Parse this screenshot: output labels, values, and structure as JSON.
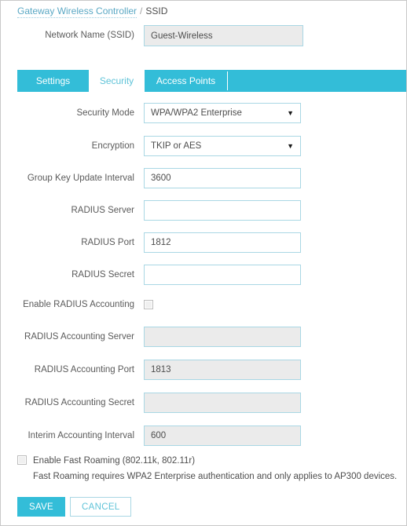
{
  "breadcrumb": {
    "link": "Gateway Wireless Controller",
    "separator": "/",
    "current": "SSID"
  },
  "network_name": {
    "label": "Network Name (SSID)",
    "value": "Guest-Wireless",
    "disabled": true
  },
  "tabs": [
    {
      "label": "Settings",
      "active": false
    },
    {
      "label": "Security",
      "active": true
    },
    {
      "label": "Access Points",
      "active": false
    }
  ],
  "form": {
    "fields": [
      {
        "name": "security-mode",
        "label": "Security Mode",
        "type": "select",
        "value": "WPA/WPA2 Enterprise",
        "arrow": "▼",
        "disabled": false
      },
      {
        "name": "encryption",
        "label": "Encryption",
        "type": "select",
        "value": "TKIP or AES",
        "arrow": "▼",
        "disabled": false
      },
      {
        "name": "group-key-update-interval",
        "label": "Group Key Update Interval",
        "type": "text",
        "value": "3600",
        "disabled": false
      },
      {
        "name": "radius-server",
        "label": "RADIUS Server",
        "type": "text",
        "value": "",
        "disabled": false
      },
      {
        "name": "radius-port",
        "label": "RADIUS Port",
        "type": "text",
        "value": "1812",
        "disabled": false
      },
      {
        "name": "radius-secret",
        "label": "RADIUS Secret",
        "type": "text",
        "value": "",
        "disabled": false
      }
    ],
    "enable_radius_accounting": {
      "label": "Enable RADIUS Accounting",
      "checked": false
    },
    "accounting_fields": [
      {
        "name": "radius-accounting-server",
        "label": "RADIUS Accounting Server",
        "type": "text",
        "value": "",
        "disabled": true
      },
      {
        "name": "radius-accounting-port",
        "label": "RADIUS Accounting Port",
        "type": "text",
        "value": "1813",
        "disabled": true
      },
      {
        "name": "radius-accounting-secret",
        "label": "RADIUS Accounting Secret",
        "type": "text",
        "value": "",
        "disabled": true
      },
      {
        "name": "interim-accounting-interval",
        "label": "Interim Accounting Interval",
        "type": "text",
        "value": "600",
        "disabled": true
      }
    ],
    "fast_roaming": {
      "label": "Enable Fast Roaming (802.11k, 802.11r)",
      "checked": false,
      "help": "Fast Roaming requires WPA2 Enterprise authentication and only applies to AP300 devices."
    }
  },
  "actions": {
    "save": "SAVE",
    "cancel": "CANCEL"
  },
  "colors": {
    "accent": "#33bdd8",
    "accent_text": "#5fc3d8",
    "field_border": "#a9d7e4",
    "disabled_bg": "#ebebeb"
  }
}
